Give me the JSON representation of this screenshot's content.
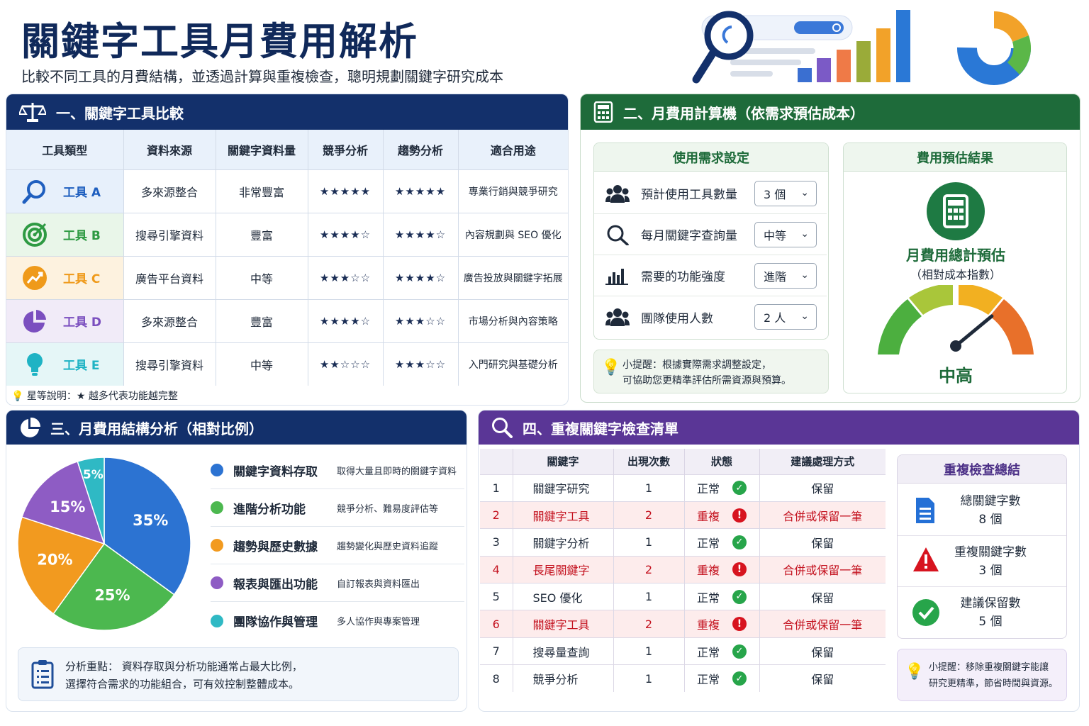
{
  "header": {
    "title": "關鍵字工具月費用解析",
    "subtitle": "比較不同工具的月費結構，並透過計算與重複檢查，聰明規劃關鍵字研究成本"
  },
  "section1": {
    "title": "一、關鍵字工具比較",
    "headers": [
      "工具類型",
      "資料來源",
      "關鍵字資料量",
      "競爭分析",
      "趨勢分析",
      "適合用途"
    ],
    "rows": [
      {
        "tool": "工具 A",
        "icon": "search-icon",
        "color": "#1f5fbf",
        "source": "多來源整合",
        "volume": "非常豐富",
        "comp": "★★★★★",
        "trend": "★★★★★",
        "use": "專業行銷與競爭研究"
      },
      {
        "tool": "工具 B",
        "icon": "target-icon",
        "color": "#2e9a43",
        "source": "搜尋引擎資料",
        "volume": "豐富",
        "comp": "★★★★☆",
        "trend": "★★★★☆",
        "use": "內容規劃與 SEO 優化"
      },
      {
        "tool": "工具 C",
        "icon": "trend-up-icon",
        "color": "#ef9a1a",
        "source": "廣告平台資料",
        "volume": "中等",
        "comp": "★★★☆☆",
        "trend": "★★★★☆",
        "use": "廣告投放與關鍵字拓展"
      },
      {
        "tool": "工具 D",
        "icon": "pie-icon",
        "color": "#7b4fbf",
        "source": "多來源整合",
        "volume": "豐富",
        "comp": "★★★★☆",
        "trend": "★★★☆☆",
        "use": "市場分析與內容策略"
      },
      {
        "tool": "工具 E",
        "icon": "lightbulb-icon",
        "color": "#1fb3c4",
        "source": "搜尋引擎資料",
        "volume": "中等",
        "comp": "★★☆☆☆",
        "trend": "★★★☆☆",
        "use": "入門研究與基礎分析"
      }
    ],
    "note": "星等說明：★ 越多代表功能越完整"
  },
  "section2": {
    "title": "二、月費用計算機（依需求預估成本）",
    "settings_title": "使用需求設定",
    "settings": [
      {
        "label": "預計使用工具數量",
        "value": "3 個",
        "icon": "users-icon"
      },
      {
        "label": "每月關鍵字查詢量",
        "value": "中等",
        "icon": "search-icon"
      },
      {
        "label": "需要的功能強度",
        "value": "進階",
        "icon": "bar-chart-icon"
      },
      {
        "label": "團隊使用人數",
        "value": "2 人",
        "icon": "team-icon"
      }
    ],
    "tip": [
      "小提醒：根據實際需求調整設定，",
      "可協助您更精準評估所需資源與預算。"
    ],
    "result_title": "費用預估結果",
    "result_label": "月費用總計預估",
    "result_sub": "（相對成本指數）",
    "result_value": "中高",
    "gauge_level": 0.78
  },
  "section3": {
    "title": "三、月費用結構分析（相對比例）",
    "chart_data": {
      "type": "pie",
      "categories": [
        "關鍵字資料存取",
        "進階分析功能",
        "趨勢與歷史數據",
        "報表與匯出功能",
        "團隊協作與管理"
      ],
      "values": [
        35,
        25,
        20,
        15,
        5
      ],
      "labels": [
        "35%",
        "25%",
        "20%",
        "15%",
        "5%"
      ],
      "colors": [
        "#2c73d2",
        "#4cb84f",
        "#f29a1f",
        "#8e5cc4",
        "#2fb9c4"
      ]
    },
    "legend_desc": [
      "取得大量且即時的關鍵字資料",
      "競爭分析、難易度評估等",
      "趨勢變化與歷史資料追蹤",
      "自訂報表與資料匯出",
      "多人協作與專案管理"
    ],
    "analysis": [
      "分析重點： 資料存取與分析功能通常占最大比例，",
      "選擇符合需求的功能組合，可有效控制整體成本。"
    ]
  },
  "section4": {
    "title": "四、重複關鍵字檢查清單",
    "headers": [
      "",
      "關鍵字",
      "出現次數",
      "狀態",
      "建議處理方式"
    ],
    "rows": [
      {
        "n": "1",
        "kw": "關鍵字研究",
        "count": "1",
        "status": "正常",
        "action": "保留",
        "dup": false
      },
      {
        "n": "2",
        "kw": "關鍵字工具",
        "count": "2",
        "status": "重複",
        "action": "合併或保留一筆",
        "dup": true
      },
      {
        "n": "3",
        "kw": "關鍵字分析",
        "count": "1",
        "status": "正常",
        "action": "保留",
        "dup": false
      },
      {
        "n": "4",
        "kw": "長尾關鍵字",
        "count": "2",
        "status": "重複",
        "action": "合併或保留一筆",
        "dup": true
      },
      {
        "n": "5",
        "kw": "SEO 優化",
        "count": "1",
        "status": "正常",
        "action": "保留",
        "dup": false
      },
      {
        "n": "6",
        "kw": "關鍵字工具",
        "count": "2",
        "status": "重複",
        "action": "合併或保留一筆",
        "dup": true
      },
      {
        "n": "7",
        "kw": "搜尋量查詢",
        "count": "1",
        "status": "正常",
        "action": "保留",
        "dup": false
      },
      {
        "n": "8",
        "kw": "競爭分析",
        "count": "1",
        "status": "正常",
        "action": "保留",
        "dup": false
      }
    ],
    "summary_title": "重複檢查總結",
    "summary": [
      {
        "label": "總關鍵字數",
        "value": "8 個"
      },
      {
        "label": "重複關鍵字數",
        "value": "3 個"
      },
      {
        "label": "建議保留數",
        "value": "5 個"
      }
    ],
    "tip": [
      "小提醒：移除重複關鍵字能讓",
      "研究更精準，節省時間與資源。"
    ]
  }
}
